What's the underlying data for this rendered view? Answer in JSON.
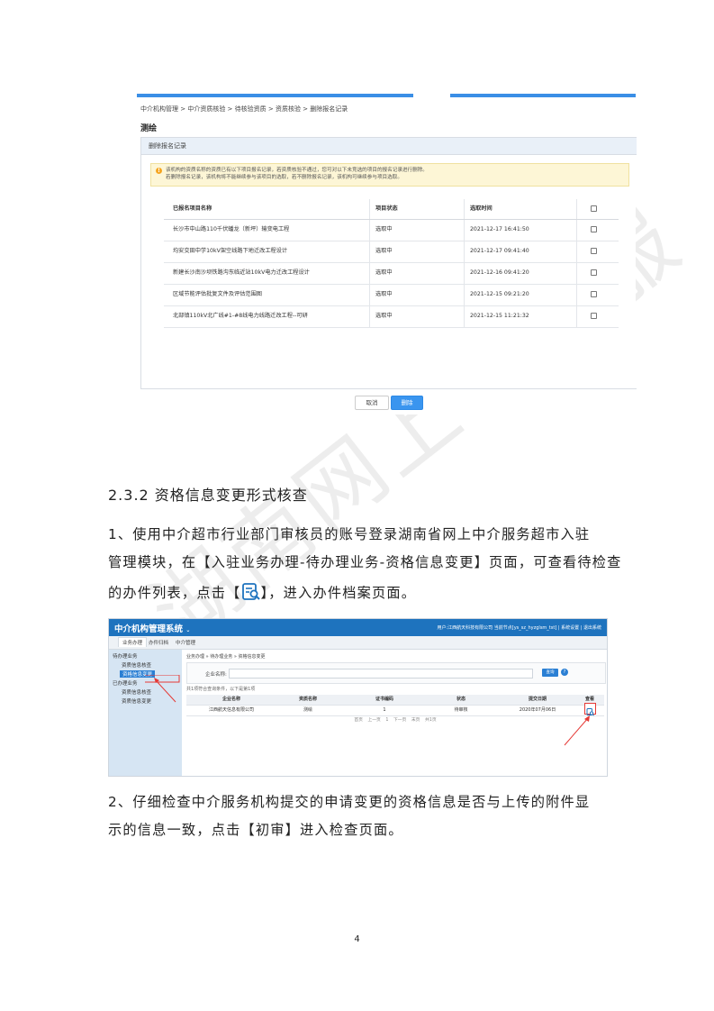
{
  "watermark": "湖南网上中介服",
  "screenshot1": {
    "breadcrumb": "中介机构管理 > 中介资质核验 > 待核验资质 > 资质核验 > 删除报名记录",
    "title": "测绘",
    "panel_title": "删除报名记录",
    "warning_line1": "该机构的资质名称的资质已有以下项目报名记录，若资质核验不通过，您可对以下未竞选的项目的报名记录进行删除。",
    "warning_line2": "若删除报名记录，该机构将不能继续参与该项目的选取，若不删除报名记录，该机构可继续参与项目选取。",
    "columns": [
      "已报名项目名称",
      "项目状态",
      "选取时间"
    ],
    "rows": [
      {
        "name": "长沙市中山路110千伏蟠龙（新坪）输变电工程",
        "status": "选取中",
        "time": "2021-12-17 16:41:50"
      },
      {
        "name": "均安交田中学10kV架空线路下地迁改工程设计",
        "status": "选取中",
        "time": "2021-12-17 09:41:40"
      },
      {
        "name": "新建长沙南沙坝铁路沟东临近站10kV电力迁改工程设计",
        "status": "选取中",
        "time": "2021-12-16 09:41:20"
      },
      {
        "name": "区域节能评估批复文件及评估范围图",
        "status": "选取中",
        "time": "2021-12-15 09:21:20"
      },
      {
        "name": "北部镇110kV北广线#1-#8线电力线路迁改工程--可研",
        "status": "选取中",
        "time": "2021-12-15 11:21:32"
      }
    ],
    "cancel_label": "取消",
    "delete_label": "删除"
  },
  "section_heading": "2.3.2 资格信息变更形式核查",
  "para1_a": "1、使用中介超市行业部门审核员的账号登录湖南省网上中介服务超市入驻",
  "para1_b": "管理模块，在【入驻业务办理-待办理业务-资格信息变更】页面，可查看待检查",
  "para1_c_pre": "的办件列表，点击【",
  "para1_c_post": "】，进入办件档案页面。",
  "screenshot2": {
    "app_title": "中介机构管理系统",
    "header_right": "用户:江西航天科技有限公司 当前节点[ys_sz_hyzglsm_tst] | 系统设置 | 退出系统",
    "tabs": [
      "业务办理",
      "办件归档",
      "中介管理"
    ],
    "sidebar": [
      "待办理业务",
      "资质信息核查",
      "资格信息变更",
      "已办理业务",
      "资质信息核查",
      "资质信息变更"
    ],
    "breadcrumb": "业务办理 » 待办理业务 » 资格信息变更",
    "query_label": "企业名称:",
    "query_button": "查询",
    "help_label": "?",
    "count_text": "共1项符合查询条件，以下是第1项",
    "columns": [
      "企业名称",
      "资质名称",
      "证书编码",
      "状态",
      "提交日期",
      "查看"
    ],
    "row": {
      "company": "江西航天信息有限公司",
      "qualification": "测绘",
      "cert": "1",
      "status": "待审核",
      "date": "2020年07月06日"
    },
    "pager": "首页 上一页 1 下一页 末页 共1页"
  },
  "para2_a": "2、仔细检查中介服务机构提交的申请变更的资格信息是否与上传的附件显",
  "para2_b": "示的信息一致，点击【初审】进入检查页面。",
  "page_number": "4",
  "colors": {
    "accent": "#3a8ee6",
    "header": "#1e73be",
    "sidebar": "#d6e5f3",
    "highlight": "#e53935"
  }
}
